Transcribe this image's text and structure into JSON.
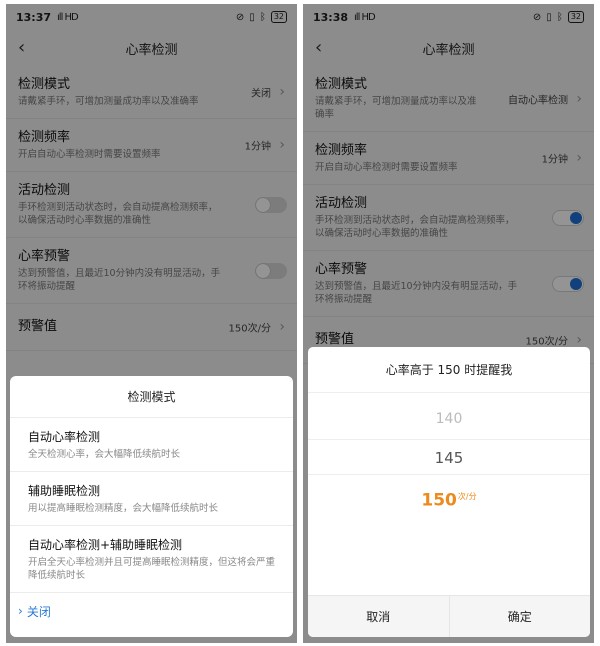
{
  "left": {
    "status": {
      "time": "13:37",
      "signal": "ıll HD",
      "battery": "32"
    },
    "title": "心率检测",
    "rows": [
      {
        "title": "检测模式",
        "desc": "请戴紧手环，可增加测量成功率以及准确率",
        "value": "关闭"
      },
      {
        "title": "检测频率",
        "desc": "开启自动心率检测时需要设置频率",
        "value": "1分钟"
      },
      {
        "title": "活动检测",
        "desc": "手环检测到活动状态时，会自动提高检测频率，以确保活动时心率数据的准确性"
      },
      {
        "title": "心率预警",
        "desc": "达到预警值，且最近10分钟内没有明显活动，手环将振动提醒"
      },
      {
        "title": "预警值",
        "value": "150次/分"
      }
    ],
    "sheet": {
      "title": "检测模式",
      "options": [
        {
          "title": "自动心率检测",
          "desc": "全天检测心率，会大幅降低续航时长"
        },
        {
          "title": "辅助睡眠检测",
          "desc": "用以提高睡眠检测精度，会大幅降低续航时长"
        },
        {
          "title": "自动心率检测+辅助睡眠检测",
          "desc": "开启全天心率检测并且可提高睡眠检测精度，但这将会严重降低续航时长"
        }
      ],
      "close_label": "关闭"
    }
  },
  "right": {
    "status": {
      "time": "13:38",
      "signal": "ıll HD",
      "battery": "32"
    },
    "title": "心率检测",
    "rows": [
      {
        "title": "检测模式",
        "desc": "请戴紧手环，可增加测量成功率以及准确率",
        "value": "自动心率检测"
      },
      {
        "title": "检测频率",
        "desc": "开启自动心率检测时需要设置频率",
        "value": "1分钟"
      },
      {
        "title": "活动检测",
        "desc": "手环检测到活动状态时，会自动提高检测频率，以确保活动时心率数据的准确性"
      },
      {
        "title": "心率预警",
        "desc": "达到预警值，且最近10分钟内没有明显活动，手环将振动提醒"
      },
      {
        "title": "预警值",
        "value": "150次/分"
      }
    ],
    "picker": {
      "title": "心率高于 150 时提醒我",
      "values": [
        "140",
        "145",
        "150"
      ],
      "unit": "次/分",
      "cancel_label": "取消",
      "confirm_label": "确定"
    }
  }
}
